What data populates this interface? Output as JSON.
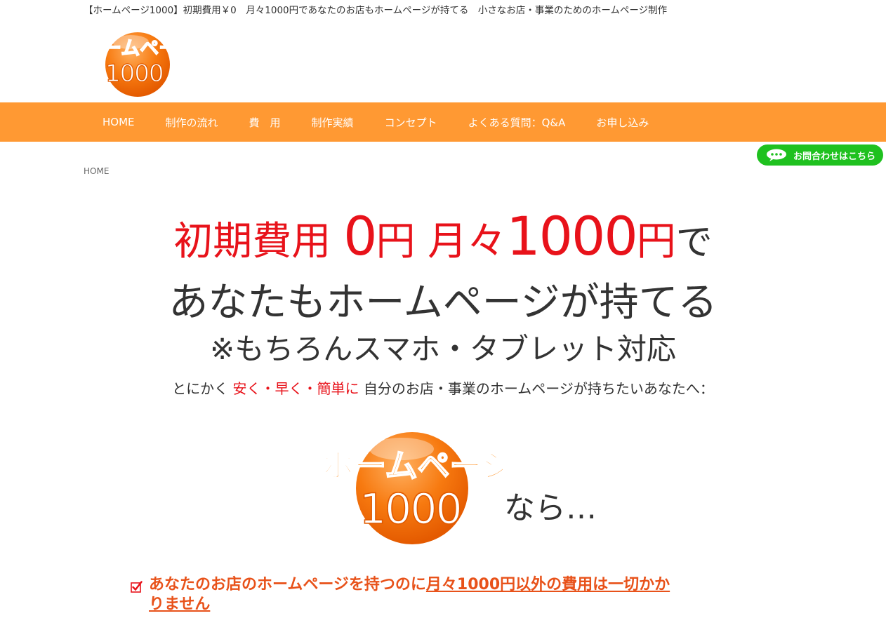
{
  "header": {
    "tagline": "【ホームページ1000】初期費用￥0　月々1000円であなたのお店もホームページが持てる　小さなお店・事業のためのホームページ制作",
    "logo": {
      "text_top": "ホームページ",
      "text_bottom": "1000"
    }
  },
  "nav": {
    "items": [
      "HOME",
      "制作の流れ",
      "費　用",
      "制作実績",
      "コンセプト",
      "よくある質問：Q&A",
      "お申し込み"
    ]
  },
  "contact_button": {
    "label": "お問合わせはこちら"
  },
  "breadcrumb": {
    "home": "HOME"
  },
  "hero": {
    "line1": {
      "a": "初期費用 ",
      "zero": "0",
      "yen1": "円 ",
      "monthly": "月々",
      "amount": "1000",
      "yen2": "円",
      "de": "で"
    },
    "line2": "あなたもホームページが持てる",
    "line3": "※もちろんスマホ・タブレット対応",
    "line4": {
      "pre": "とにかく ",
      "highlight": "安く・早く・簡単に",
      "post": " 自分のお店・事業のホームページが持ちたいあなたへ："
    },
    "logo": {
      "text_top": "ホームページ",
      "text_bottom": "1000"
    },
    "nara": "なら…"
  },
  "features": {
    "item1": {
      "pre": "あなたのお店のホームページを持つのに",
      "underlined": "月々1000円以外の費用は一切かか",
      "line2": "りません"
    }
  },
  "colors": {
    "accent": "#ff9933",
    "red": "#e8121a",
    "orange_text": "#e8521a",
    "contact_green": "#1fc11f"
  }
}
